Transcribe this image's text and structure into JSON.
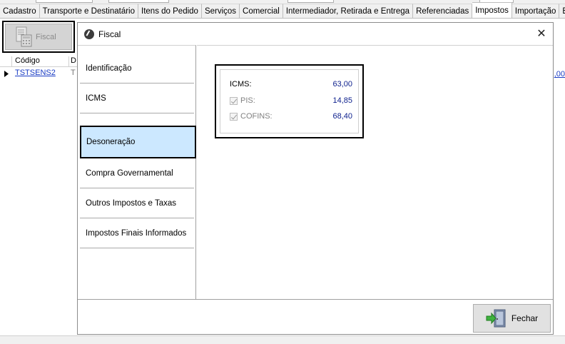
{
  "tabs": [
    {
      "label": "Cadastro"
    },
    {
      "label": "Transporte e Destinatário"
    },
    {
      "label": "Itens do Pedido"
    },
    {
      "label": "Serviços"
    },
    {
      "label": "Comercial"
    },
    {
      "label": "Intermediador, Retirada e Entrega"
    },
    {
      "label": "Referenciadas"
    },
    {
      "label": "Impostos",
      "active": true
    },
    {
      "label": "Importação"
    },
    {
      "label": "Ex"
    }
  ],
  "toolbar": {
    "fiscal_label": "Fiscal"
  },
  "grid": {
    "header_codigo": "Código",
    "header_next": "D",
    "row_codigo": "TSTSENS2",
    "row_next": "T",
    "right_value": ",00"
  },
  "modal": {
    "title": "Fiscal",
    "close_glyph": "✕",
    "nav": [
      {
        "label": "Identificação"
      },
      {
        "label": "ICMS"
      },
      {
        "label": "Desoneração",
        "selected": true
      },
      {
        "label": "Compra Governamental"
      },
      {
        "label": "Outros Impostos e Taxas"
      },
      {
        "label": "Impostos Finais Informados"
      }
    ],
    "values": {
      "icms_label": "ICMS:",
      "icms_value": "63,00",
      "pis_label": "PIS:",
      "pis_value": "14,85",
      "cofins_label": "COFINS:",
      "cofins_value": "68,40"
    },
    "close_button": "Fechar"
  },
  "colors": {
    "selection": "#cce8ff",
    "value_text": "#0b1e8c",
    "link": "#1a3cc4"
  }
}
